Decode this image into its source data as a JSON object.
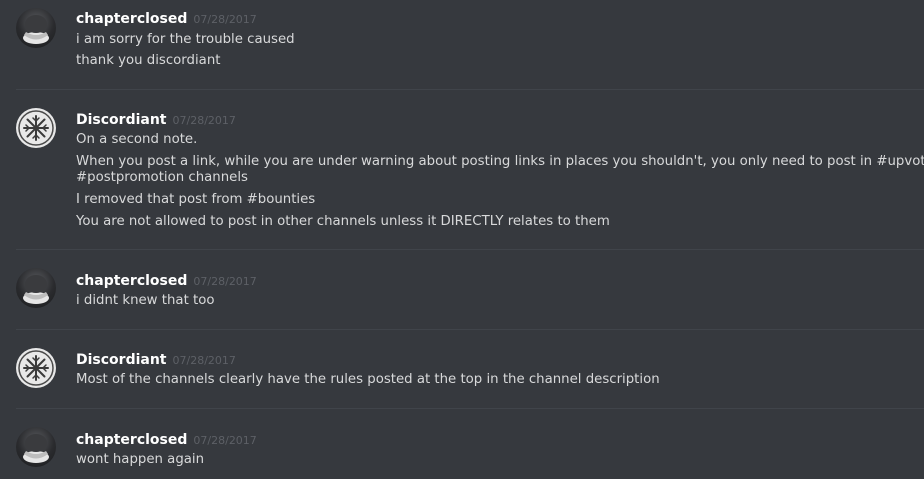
{
  "messages": [
    {
      "username": "chapterclosed",
      "timestamp": "07/28/2017",
      "avatar": "dark-mask-avatar",
      "lines": [
        "i am sorry for the trouble caused",
        "thank you discordiant"
      ]
    },
    {
      "username": "Discordiant",
      "timestamp": "07/28/2017",
      "avatar": "snowflake-symbol-avatar",
      "lines": [
        "On a second note.",
        "When you post a link, while you are under warning about posting links in places you shouldn't, you only need to post in #upvote or",
        "#postpromotion channels",
        "I removed that post from #bounties",
        "You are not allowed to post in other channels unless it DIRECTLY relates to them"
      ]
    },
    {
      "username": "chapterclosed",
      "timestamp": "07/28/2017",
      "avatar": "dark-mask-avatar",
      "lines": [
        "i didnt knew that too"
      ]
    },
    {
      "username": "Discordiant",
      "timestamp": "07/28/2017",
      "avatar": "snowflake-symbol-avatar",
      "lines": [
        "Most of the channels clearly have the rules posted at the top in the channel description"
      ]
    },
    {
      "username": "chapterclosed",
      "timestamp": "07/28/2017",
      "avatar": "dark-mask-avatar",
      "lines": [
        "wont happen again"
      ]
    }
  ]
}
